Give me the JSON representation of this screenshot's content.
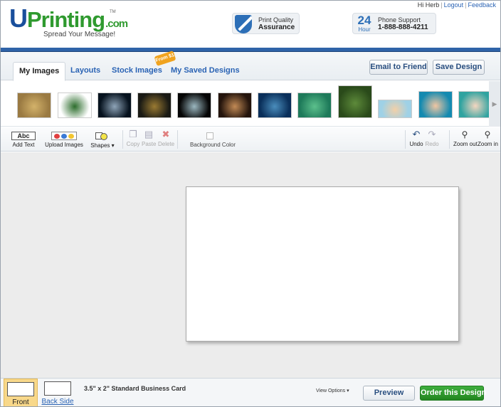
{
  "header": {
    "logo_u": "U",
    "logo_rest": "Printing",
    "logo_com": ".com",
    "logo_tm": "TM",
    "tagline": "Spread Your Message!",
    "greeting": "Hi Herb",
    "logout": "Logout",
    "feedback": "Feedback",
    "quality_line1": "Print Quality",
    "quality_line2": "Assurance",
    "support_24": "24",
    "support_hour": "Hour",
    "support_line1": "Phone Support",
    "support_line2": "1-888-888-4211"
  },
  "tabs": {
    "my_images": "My Images",
    "layouts": "Layouts",
    "stock_images": "Stock Images",
    "stock_badge": "From $1",
    "saved_designs": "My Saved Designs",
    "email_button": "Email to Friend",
    "save_button": "Save Design"
  },
  "thumbnails": [
    {
      "color": "#9a7a42",
      "accent": "#d3b26a",
      "icon": "glass-jar-image"
    },
    {
      "color": "#ffffff",
      "accent": "#2c6d2c",
      "icon": "logo-banner-image"
    },
    {
      "color": "#06121e",
      "accent": "#8ea4b8",
      "icon": "shark-image"
    },
    {
      "color": "#1a1a14",
      "accent": "#9a7a32",
      "icon": "shipwreck-poster-image"
    },
    {
      "color": "#050505",
      "accent": "#9bb7c0",
      "icon": "triggerfish-image"
    },
    {
      "color": "#24140c",
      "accent": "#c28a55",
      "icon": "crab-image"
    },
    {
      "color": "#0a2f5a",
      "accent": "#4a8dbc",
      "icon": "sea-turtle-image"
    },
    {
      "color": "#1e7a5a",
      "accent": "#5cc08c",
      "icon": "diver-image"
    },
    {
      "color": "#2a4a1a",
      "accent": "#5d8a3a",
      "icon": "kelp-image"
    },
    {
      "color": "#9fd1e6",
      "accent": "#f2d0a8",
      "icon": "jellyfish-light-image"
    },
    {
      "color": "#148ab0",
      "accent": "#f1c6a2",
      "icon": "jellyfish-blue-image"
    },
    {
      "color": "#2fa3a0",
      "accent": "#f4d6c0",
      "icon": "jellyfish-teal-image"
    }
  ],
  "toolbar": {
    "add_text_glyph": "Abc",
    "add_text": "Add Text",
    "upload_images": "Upload Images",
    "shapes": "Shapes",
    "copy": "Copy",
    "paste": "Paste",
    "delete": "Delete",
    "background_color": "Background Color",
    "undo": "Undo",
    "redo": "Redo",
    "zoom_out": "Zoom out",
    "zoom_in": "Zoom in"
  },
  "bottom": {
    "front_side": "Front Side",
    "back_side": "Back Side",
    "card_size": "3.5\" x 2\" Standard Business Card",
    "view_options": "View Options",
    "preview": "Preview",
    "order": "Order this Design"
  },
  "colors": {
    "brand_blue": "#1a4f9c",
    "brand_green": "#2f9a2f",
    "bar_blue": "#2f63a8",
    "order_green": "#2a9a2a",
    "front_highlight": "#f8d88a"
  }
}
